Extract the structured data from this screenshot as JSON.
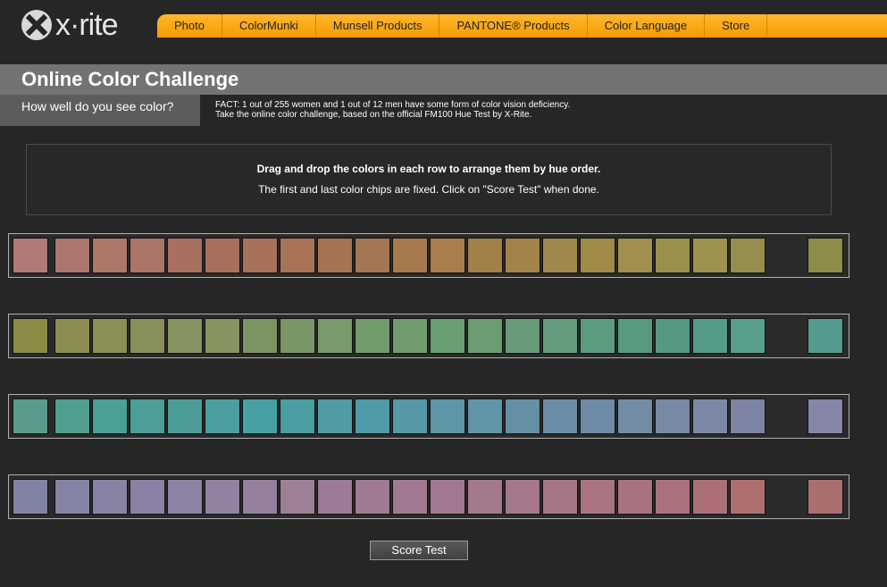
{
  "brand": {
    "logo_text": "x·rite",
    "logo_icon": "x-rite-logo-icon"
  },
  "nav": {
    "items": [
      "Photo",
      "ColorMunki",
      "Munsell Products",
      "PANTONE® Products",
      "Color Language",
      "Store"
    ]
  },
  "header": {
    "title": "Online Color Challenge",
    "subtitle": "How well do you see color?",
    "fact_line1": "FACT: 1 out of 255 women and 1 out of 12 men have some form of color vision deficiency.",
    "fact_line2": "Take the online color challenge, based on the official FM100 Hue Test by X-Rite."
  },
  "instructions": {
    "line1": "Drag and drop the colors in each row to arrange them by hue order.",
    "line2": "The first and last color chips are fixed. Click on \"Score Test\" when done."
  },
  "rows": [
    [
      "#b07a78",
      "#ad7570",
      "#ad776a",
      "#ac7569",
      "#a9705f",
      "#a8705c",
      "#a87159",
      "#a87356",
      "#a57552",
      "#a47753",
      "#a67a4e",
      "#a87e4e",
      "#a37f4a",
      "#a4834a",
      "#a2874c",
      "#9f8a48",
      "#a08f4d",
      "#99904c",
      "#9c934f",
      "#968e4f",
      "#8d8d47"
    ],
    [
      "#8d8a45",
      "#8c8c50",
      "#8b8e56",
      "#898f5a",
      "#879360",
      "#86955f",
      "#7b9462",
      "#7a9566",
      "#7b9a6c",
      "#749b6e",
      "#719c70",
      "#699e72",
      "#6a9d74",
      "#689c78",
      "#639c7a",
      "#5c9c7e",
      "#589a80",
      "#559983",
      "#549b89",
      "#589e8b",
      "#559a8f"
    ],
    [
      "#5a9b8f",
      "#4f9e90",
      "#49a095",
      "#4c9e96",
      "#4c9d98",
      "#4a9e9f",
      "#47a1a2",
      "#4a9da1",
      "#509ca4",
      "#4e9aa6",
      "#5798a6",
      "#5c96a7",
      "#6294a7",
      "#6490a6",
      "#6a8ea8",
      "#6e8aa6",
      "#728ca6",
      "#7888a5",
      "#7c88a5",
      "#7c84a3",
      "#8686a8"
    ],
    [
      "#8083a4",
      "#8583a4",
      "#8a82a5",
      "#8b81a4",
      "#8d82a4",
      "#92819f",
      "#95819d",
      "#9b8098",
      "#9b7b96",
      "#9f7a95",
      "#a27993",
      "#a27791",
      "#a3788d",
      "#a6778a",
      "#a67483",
      "#a97382",
      "#a8727e",
      "#ab717b",
      "#ab6f78",
      "#ae6f70",
      "#aa6e6f"
    ]
  ],
  "score_button": "Score Test"
}
